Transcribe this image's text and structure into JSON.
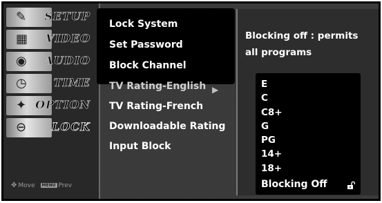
{
  "sidebar": {
    "tabs": [
      {
        "label": "SETUP",
        "icon": "wrench-icon"
      },
      {
        "label": "VIDEO",
        "icon": "film-icon"
      },
      {
        "label": "AUDIO",
        "icon": "speaker-icon"
      },
      {
        "label": "TIME",
        "icon": "clock-icon"
      },
      {
        "label": "OPTION",
        "icon": "option-icon"
      },
      {
        "label": "LOCK",
        "icon": "lock-icon"
      }
    ],
    "active": "LOCK",
    "footer": {
      "move_label": "Move",
      "menu_key": "MENU",
      "prev_label": "Prev"
    }
  },
  "lock_menu": {
    "items": [
      "Lock System",
      "Set Password",
      "Block Channel",
      "TV Rating-English",
      "TV Rating-French",
      "Downloadable Rating",
      "Input Block"
    ],
    "selected": "TV Rating-English"
  },
  "help": {
    "text": "Blocking off : permits all programs"
  },
  "ratings": {
    "items": [
      "E",
      "C",
      "C8+",
      "G",
      "PG",
      "14+",
      "18+",
      "Blocking Off"
    ],
    "selected": "Blocking Off",
    "selected_icon": "unlocked-padlock-icon"
  },
  "colors": {
    "osd_background": "#2a2a2a",
    "text": "#ffffff",
    "highlight_text": "#cfcfcf"
  }
}
